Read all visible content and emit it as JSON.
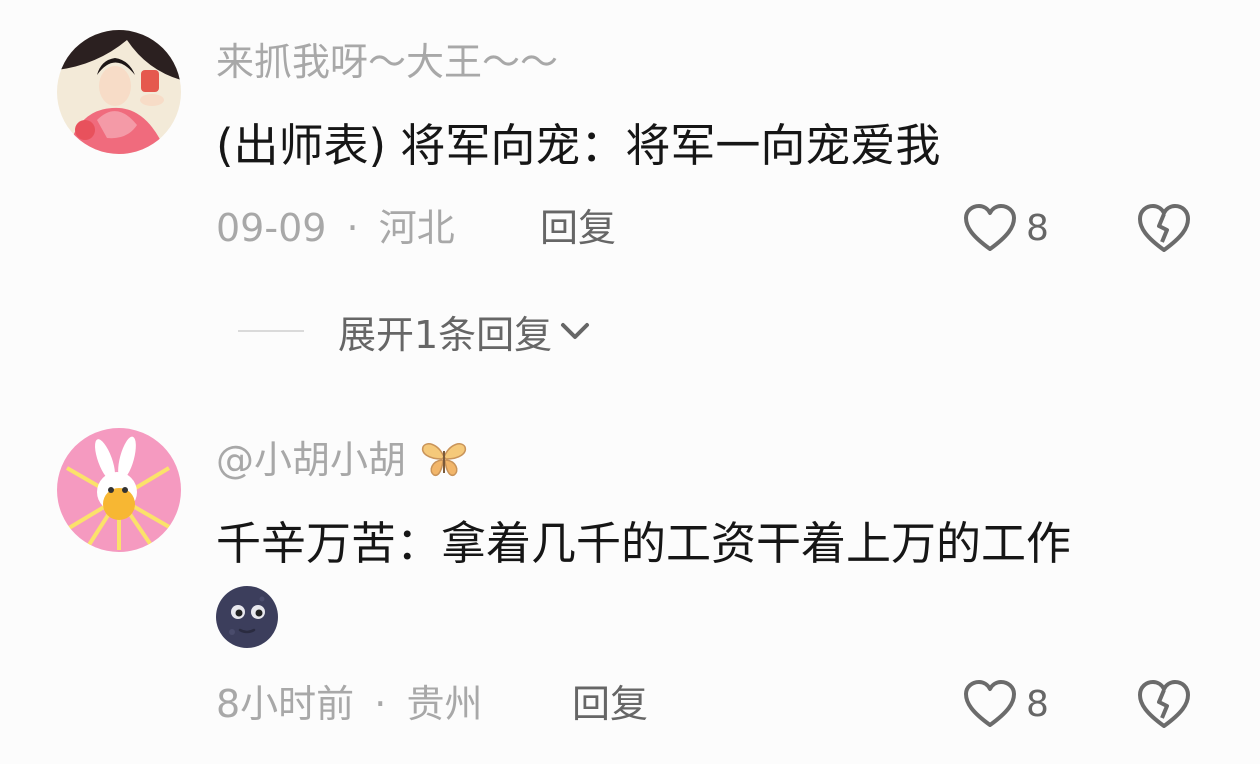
{
  "comments": [
    {
      "username": "来抓我呀～大王～～",
      "text": "(出师表) 将军向宠：将军一向宠爱我",
      "date": "09-09",
      "separator": "·",
      "location": "河北",
      "reply_label": "回复",
      "like_count": "8",
      "expand_label": "展开1条回复"
    },
    {
      "username": "@小胡小胡",
      "text": "千辛万苦：拿着几千的工资干着上万的工作",
      "date": "8小时前",
      "separator": "·",
      "location": "贵州",
      "reply_label": "回复",
      "like_count": "8",
      "emoji": "new-moon-face-emoji",
      "username_badge": "butterfly-icon"
    }
  ],
  "icons": {
    "like": "heart-outline-icon",
    "dislike": "broken-heart-icon",
    "expand": "chevron-down-icon"
  },
  "colors": {
    "background": "#fcfcfc",
    "text": "#161616",
    "muted": "#a8a8a8",
    "action": "#666666"
  }
}
